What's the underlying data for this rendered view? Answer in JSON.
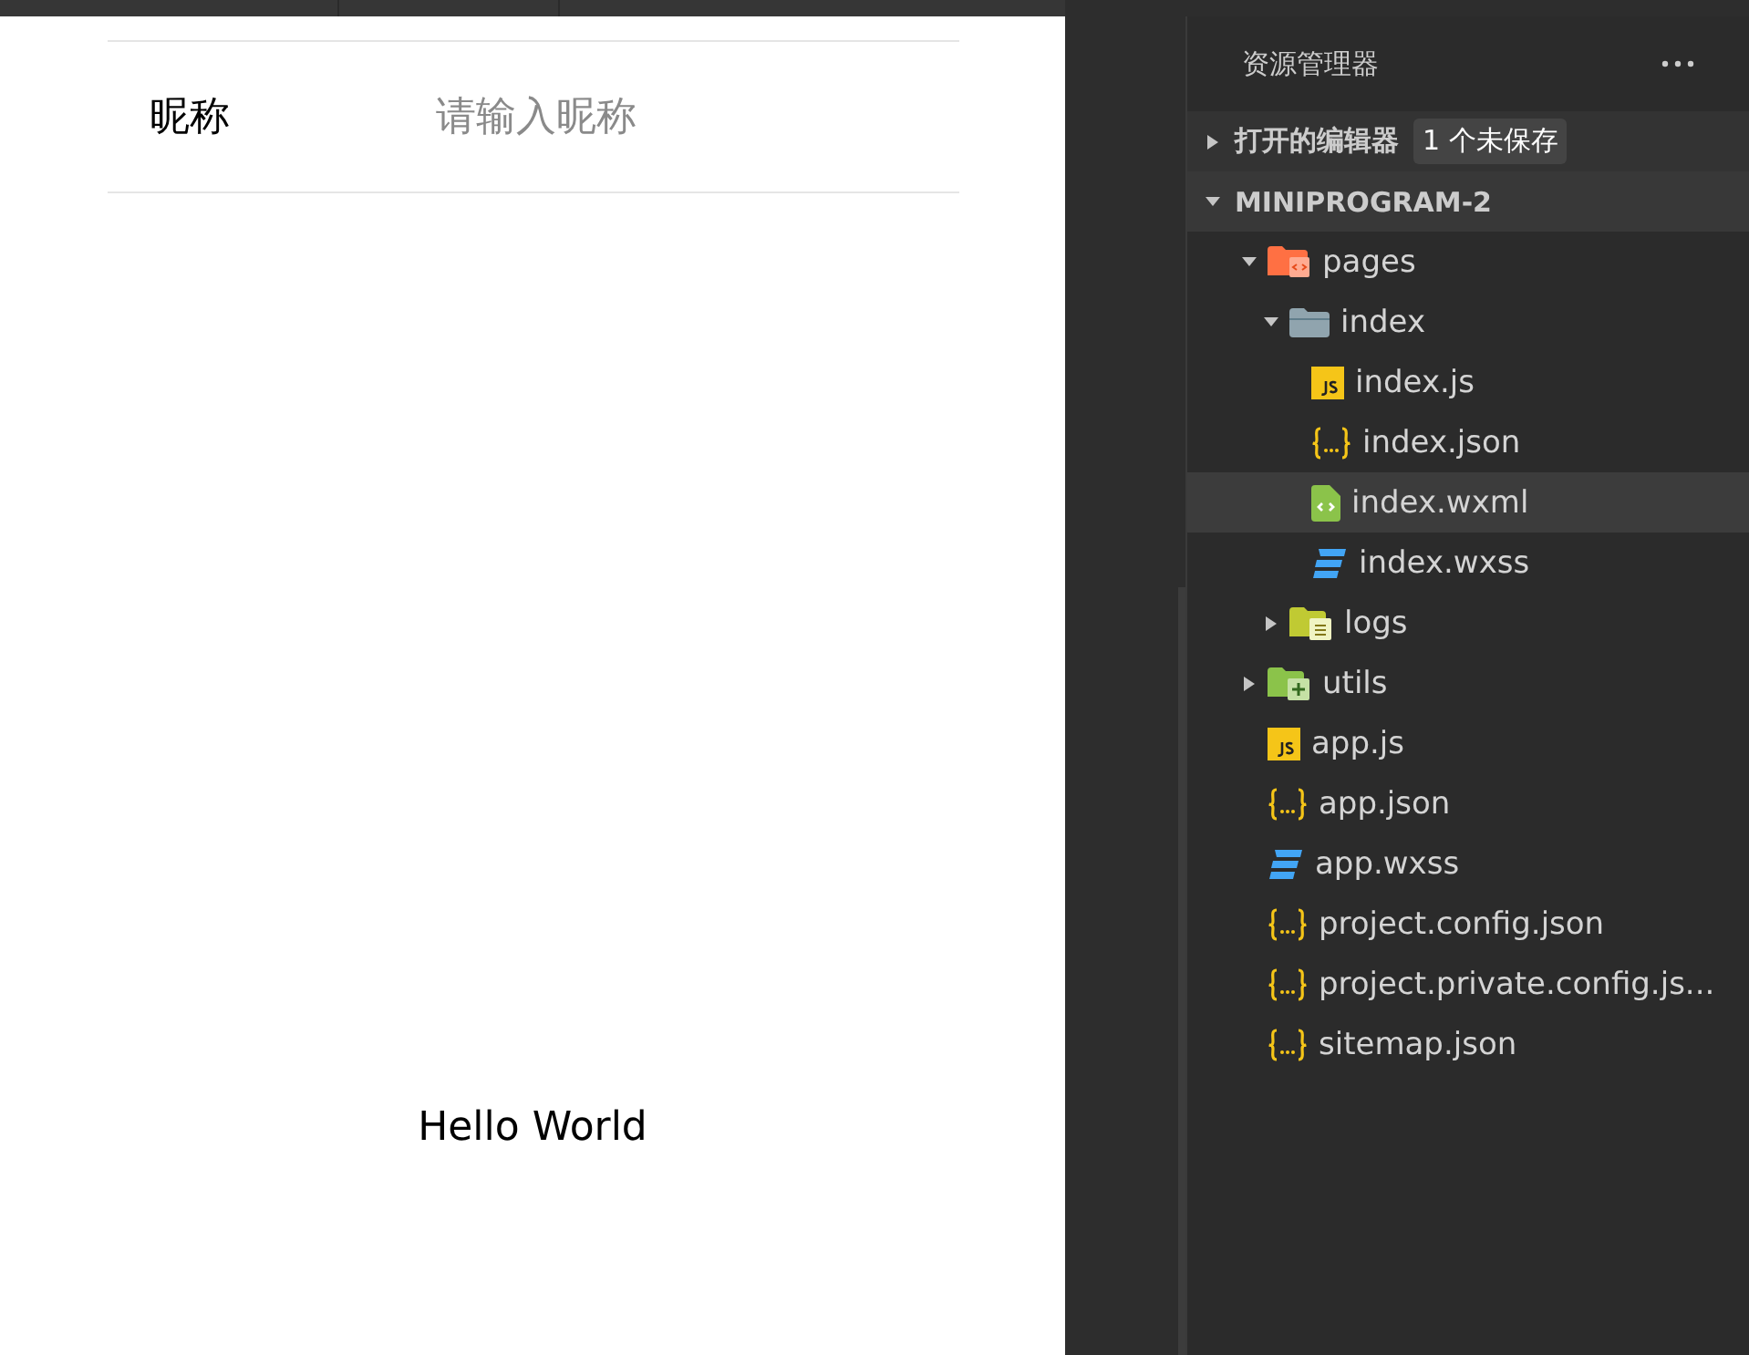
{
  "preview": {
    "form_row": {
      "label": "昵称",
      "placeholder": "请输入昵称"
    },
    "greeting": "Hello World"
  },
  "explorer": {
    "title": "资源管理器",
    "sections": [
      {
        "title": "打开的编辑器",
        "expanded": false,
        "badge": "1 个未保存"
      },
      {
        "title": "MINIPROGRAM-2",
        "expanded": true,
        "children": [
          {
            "name": "pages",
            "kind": "pages-folder",
            "expanded": true,
            "selected": false,
            "children": [
              {
                "name": "index",
                "kind": "folder",
                "expanded": true,
                "selected": false,
                "children": [
                  {
                    "name": "index.js",
                    "kind": "js",
                    "selected": false
                  },
                  {
                    "name": "index.json",
                    "kind": "json",
                    "selected": false
                  },
                  {
                    "name": "index.wxml",
                    "kind": "wxml",
                    "selected": true
                  },
                  {
                    "name": "index.wxss",
                    "kind": "wxss",
                    "selected": false
                  }
                ]
              },
              {
                "name": "logs",
                "kind": "logs-folder",
                "expanded": false,
                "selected": false
              }
            ]
          },
          {
            "name": "utils",
            "kind": "utils-folder",
            "expanded": false,
            "selected": false
          },
          {
            "name": "app.js",
            "kind": "js",
            "selected": false
          },
          {
            "name": "app.json",
            "kind": "json",
            "selected": false
          },
          {
            "name": "app.wxss",
            "kind": "wxss",
            "selected": false
          },
          {
            "name": "project.config.json",
            "kind": "json",
            "selected": false
          },
          {
            "name": "project.private.config.js...",
            "kind": "json",
            "selected": false
          },
          {
            "name": "sitemap.json",
            "kind": "json",
            "selected": false
          }
        ]
      }
    ]
  }
}
